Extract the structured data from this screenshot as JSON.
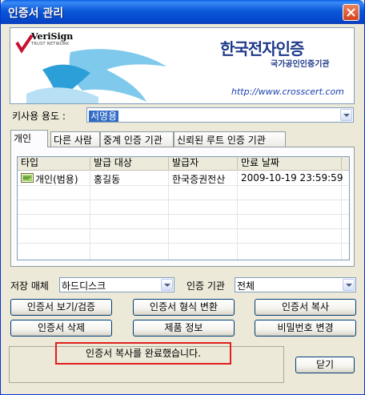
{
  "window": {
    "title": "인증서 관리"
  },
  "banner": {
    "verisign_name": "VeriSign",
    "verisign_sub": "TRUST NETWORK",
    "brand_title": "한국전자인증",
    "brand_sub": "국가공인인증기관",
    "brand_url": "http://www.crosscert.com"
  },
  "usage": {
    "label": "키사용 용도 :",
    "value": "서명용"
  },
  "tabs": [
    {
      "label": "개인",
      "active": true
    },
    {
      "label": "다른 사람"
    },
    {
      "label": "중계 인증 기관"
    },
    {
      "label": "신뢰된 루트 인증 기관"
    }
  ],
  "list": {
    "columns": [
      "타입",
      "발급 대상",
      "발급자",
      "만료 날짜"
    ],
    "rows": [
      {
        "type": "개인(범용)",
        "subject": "홍길동",
        "issuer": "한국증권전산",
        "expiry": "2009-10-19 23:59:59",
        "icon": "certificate-icon"
      }
    ]
  },
  "storage": {
    "label": "저장 매체",
    "value": "하드디스크"
  },
  "authority": {
    "label": "인증 기관",
    "value": "전체"
  },
  "buttons": {
    "view": "인증서 보기/검증",
    "convert": "인증서 형식 변환",
    "copy": "인증서 복사",
    "delete": "인증서 삭제",
    "product_info": "제품 정보",
    "change_password": "비밀번호 변경",
    "close": "닫기"
  },
  "status": {
    "message": "인증서 복사를 완료했습니다."
  },
  "colors": {
    "title_bar": "#0a58d8",
    "selection": "#316ac5",
    "highlight_border": "#e02020"
  }
}
